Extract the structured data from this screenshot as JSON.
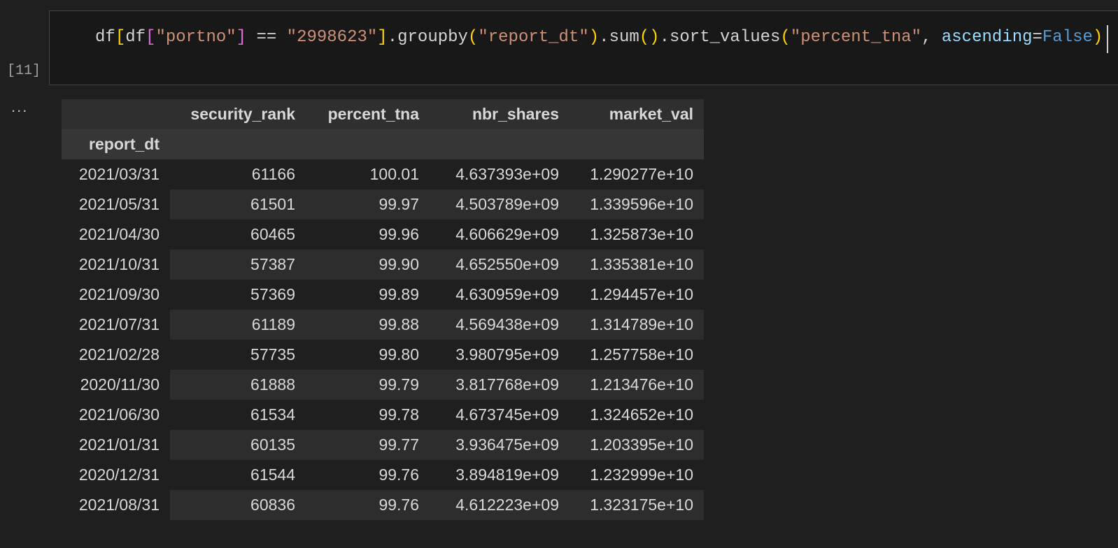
{
  "cell": {
    "execution_count": "[11]",
    "code_tokens": [
      {
        "t": "df",
        "c": ""
      },
      {
        "t": "[",
        "c": "tk-b1"
      },
      {
        "t": "df",
        "c": ""
      },
      {
        "t": "[",
        "c": "tk-b2"
      },
      {
        "t": "\"portno\"",
        "c": "tk-str"
      },
      {
        "t": "]",
        "c": "tk-b2"
      },
      {
        "t": " == ",
        "c": ""
      },
      {
        "t": "\"2998623\"",
        "c": "tk-str"
      },
      {
        "t": "]",
        "c": "tk-b1"
      },
      {
        "t": ".groupby",
        "c": ""
      },
      {
        "t": "(",
        "c": "tk-b1"
      },
      {
        "t": "\"report_dt\"",
        "c": "tk-str"
      },
      {
        "t": ")",
        "c": "tk-b1"
      },
      {
        "t": ".sum",
        "c": ""
      },
      {
        "t": "()",
        "c": "tk-b1"
      },
      {
        "t": ".sort_values",
        "c": ""
      },
      {
        "t": "(",
        "c": "tk-b1"
      },
      {
        "t": "\"percent_tna\"",
        "c": "tk-str"
      },
      {
        "t": ", ",
        "c": ""
      },
      {
        "t": "ascending",
        "c": "tk-kw"
      },
      {
        "t": "=",
        "c": ""
      },
      {
        "t": "False",
        "c": "tk-const"
      },
      {
        "t": ")",
        "c": "tk-b1"
      }
    ]
  },
  "output": {
    "ellipsis": "...",
    "columns": [
      "security_rank",
      "percent_tna",
      "nbr_shares",
      "market_val"
    ],
    "index_name": "report_dt",
    "rows": [
      [
        "2021/03/31",
        "61166",
        "100.01",
        "4.637393e+09",
        "1.290277e+10"
      ],
      [
        "2021/05/31",
        "61501",
        "99.97",
        "4.503789e+09",
        "1.339596e+10"
      ],
      [
        "2021/04/30",
        "60465",
        "99.96",
        "4.606629e+09",
        "1.325873e+10"
      ],
      [
        "2021/10/31",
        "57387",
        "99.90",
        "4.652550e+09",
        "1.335381e+10"
      ],
      [
        "2021/09/30",
        "57369",
        "99.89",
        "4.630959e+09",
        "1.294457e+10"
      ],
      [
        "2021/07/31",
        "61189",
        "99.88",
        "4.569438e+09",
        "1.314789e+10"
      ],
      [
        "2021/02/28",
        "57735",
        "99.80",
        "3.980795e+09",
        "1.257758e+10"
      ],
      [
        "2020/11/30",
        "61888",
        "99.79",
        "3.817768e+09",
        "1.213476e+10"
      ],
      [
        "2021/06/30",
        "61534",
        "99.78",
        "4.673745e+09",
        "1.324652e+10"
      ],
      [
        "2021/01/31",
        "60135",
        "99.77",
        "3.936475e+09",
        "1.203395e+10"
      ],
      [
        "2020/12/31",
        "61544",
        "99.76",
        "3.894819e+09",
        "1.232999e+10"
      ],
      [
        "2021/08/31",
        "60836",
        "99.76",
        "4.612223e+09",
        "1.323175e+10"
      ]
    ]
  }
}
